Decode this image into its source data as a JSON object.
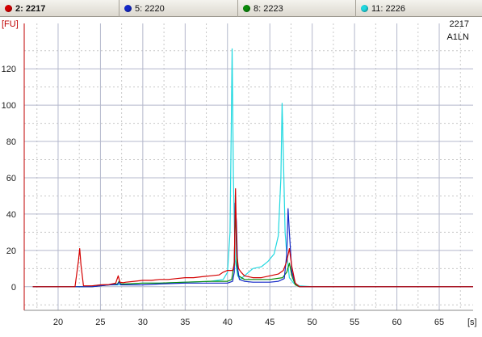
{
  "tabs": [
    {
      "label": "2: 2217",
      "color": "#d40000",
      "selected": true
    },
    {
      "label": "5: 2220",
      "color": "#1428c8",
      "selected": false
    },
    {
      "label": "8: 2223",
      "color": "#0a8a0a",
      "selected": false
    },
    {
      "label": "11: 2226",
      "color": "#20d8e0",
      "selected": false
    }
  ],
  "annotations": [
    "2217",
    "A1LN"
  ],
  "chart_data": {
    "type": "line",
    "y_unit": "[FU]",
    "x_unit": "[s]",
    "xlim": [
      16,
      69
    ],
    "ylim": [
      -13,
      145
    ],
    "x_ticks": [
      20,
      25,
      30,
      35,
      40,
      45,
      50,
      55,
      60,
      65
    ],
    "y_ticks": [
      0,
      20,
      40,
      60,
      80,
      100,
      120
    ],
    "grid": true,
    "series": [
      {
        "name": "2: 2217",
        "color": "#d40000",
        "points": [
          [
            17,
            0
          ],
          [
            22.0,
            0
          ],
          [
            22.4,
            14
          ],
          [
            22.55,
            21
          ],
          [
            22.7,
            12
          ],
          [
            23.0,
            0.5
          ],
          [
            24,
            0.5
          ],
          [
            25,
            1
          ],
          [
            26,
            1.2
          ],
          [
            26.8,
            2
          ],
          [
            27.1,
            6
          ],
          [
            27.3,
            2.5
          ],
          [
            27.7,
            2.2
          ],
          [
            28,
            2.5
          ],
          [
            29,
            3
          ],
          [
            30,
            3.5
          ],
          [
            31,
            3.5
          ],
          [
            32,
            4
          ],
          [
            33,
            4
          ],
          [
            34,
            4.5
          ],
          [
            35,
            5
          ],
          [
            36,
            5
          ],
          [
            37,
            5.5
          ],
          [
            38,
            6
          ],
          [
            39,
            6.5
          ],
          [
            39.5,
            8
          ],
          [
            40,
            9
          ],
          [
            40.4,
            9
          ],
          [
            40.6,
            9
          ],
          [
            40.8,
            12
          ],
          [
            40.95,
            54
          ],
          [
            41.1,
            18
          ],
          [
            41.3,
            10
          ],
          [
            41.6,
            8
          ],
          [
            42,
            6
          ],
          [
            43,
            5
          ],
          [
            44,
            5
          ],
          [
            45,
            6
          ],
          [
            46,
            7
          ],
          [
            46.6,
            9
          ],
          [
            47.0,
            14
          ],
          [
            47.3,
            21
          ],
          [
            47.6,
            11
          ],
          [
            48.0,
            2
          ],
          [
            48.5,
            0
          ],
          [
            55,
            0
          ],
          [
            69,
            0
          ]
        ]
      },
      {
        "name": "5: 2220",
        "color": "#1428c8",
        "points": [
          [
            17,
            0
          ],
          [
            24,
            0
          ],
          [
            25,
            0.5
          ],
          [
            26,
            1
          ],
          [
            27,
            1.2
          ],
          [
            27.2,
            2.5
          ],
          [
            27.4,
            1
          ],
          [
            28,
            1
          ],
          [
            30,
            1
          ],
          [
            32,
            1.5
          ],
          [
            35,
            2
          ],
          [
            38,
            2
          ],
          [
            40,
            2
          ],
          [
            40.6,
            3
          ],
          [
            40.8,
            8
          ],
          [
            40.9,
            46
          ],
          [
            41.05,
            36
          ],
          [
            41.2,
            10
          ],
          [
            41.4,
            4
          ],
          [
            42,
            3
          ],
          [
            43,
            2.5
          ],
          [
            45,
            2.5
          ],
          [
            46,
            3
          ],
          [
            46.7,
            4.5
          ],
          [
            47.0,
            18
          ],
          [
            47.15,
            43
          ],
          [
            47.3,
            30
          ],
          [
            47.6,
            8
          ],
          [
            48,
            2
          ],
          [
            48.5,
            0
          ],
          [
            55,
            0
          ],
          [
            69,
            0
          ]
        ]
      },
      {
        "name": "8: 2223",
        "color": "#0a8a0a",
        "points": [
          [
            17,
            0
          ],
          [
            24,
            0
          ],
          [
            25,
            0.5
          ],
          [
            26,
            1
          ],
          [
            27,
            1.5
          ],
          [
            27.2,
            3
          ],
          [
            27.4,
            1.5
          ],
          [
            28,
            1.5
          ],
          [
            30,
            2
          ],
          [
            32,
            2
          ],
          [
            35,
            2.5
          ],
          [
            38,
            3
          ],
          [
            40,
            3
          ],
          [
            40.5,
            4
          ],
          [
            40.7,
            10
          ],
          [
            40.8,
            14
          ],
          [
            40.95,
            46
          ],
          [
            41.1,
            12
          ],
          [
            41.3,
            6
          ],
          [
            42,
            4
          ],
          [
            43,
            4
          ],
          [
            45,
            4
          ],
          [
            46.5,
            5
          ],
          [
            47.0,
            8
          ],
          [
            47.3,
            13
          ],
          [
            47.6,
            6
          ],
          [
            48,
            1
          ],
          [
            48.5,
            0
          ],
          [
            55,
            0
          ],
          [
            69,
            0
          ]
        ]
      },
      {
        "name": "11: 2226",
        "color": "#20d8e0",
        "points": [
          [
            17,
            0
          ],
          [
            23,
            0
          ],
          [
            24,
            0.5
          ],
          [
            25,
            1
          ],
          [
            26,
            1
          ],
          [
            27,
            1
          ],
          [
            28,
            1.5
          ],
          [
            30,
            2
          ],
          [
            32,
            2
          ],
          [
            35,
            2.5
          ],
          [
            38,
            3
          ],
          [
            39.5,
            4
          ],
          [
            40.0,
            8
          ],
          [
            40.3,
            30
          ],
          [
            40.45,
            90
          ],
          [
            40.55,
            131
          ],
          [
            40.7,
            60
          ],
          [
            40.9,
            15
          ],
          [
            41.2,
            6
          ],
          [
            41.5,
            4
          ],
          [
            42,
            6
          ],
          [
            43,
            10
          ],
          [
            44,
            11
          ],
          [
            44.8,
            14
          ],
          [
            45.5,
            18
          ],
          [
            46.0,
            28
          ],
          [
            46.3,
            60
          ],
          [
            46.45,
            101
          ],
          [
            46.6,
            72
          ],
          [
            46.8,
            30
          ],
          [
            47.0,
            18
          ],
          [
            47.3,
            5
          ],
          [
            47.8,
            2
          ],
          [
            48.5,
            0.5
          ],
          [
            50,
            0
          ],
          [
            69,
            0
          ]
        ]
      }
    ]
  }
}
